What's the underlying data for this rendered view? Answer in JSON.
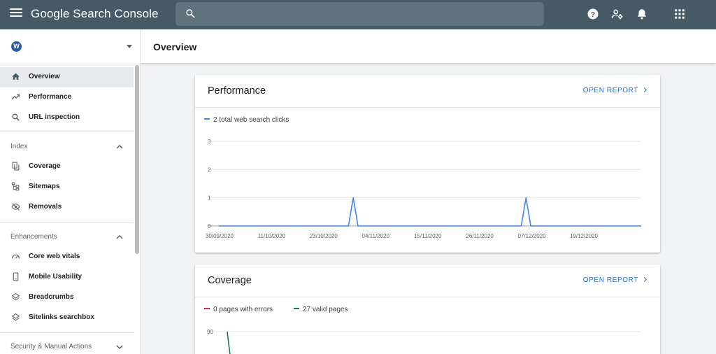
{
  "app": {
    "title": "Google Search Console",
    "search": {
      "value": "",
      "placeholder": ""
    }
  },
  "topbar_icons": [
    "menu-icon",
    "search-icon",
    "help-icon",
    "manage-users-icon",
    "notifications-icon",
    "apps-grid-icon"
  ],
  "property": {
    "logo_letter": "W",
    "icon": "wordpress-icon"
  },
  "sidebar": {
    "main_items": [
      {
        "label": "Overview",
        "icon": "home-icon",
        "active": true
      },
      {
        "label": "Performance",
        "icon": "trending-up-icon"
      },
      {
        "label": "URL inspection",
        "icon": "search-icon"
      }
    ],
    "sections": [
      {
        "title": "Index",
        "expanded": true,
        "items": [
          {
            "label": "Coverage",
            "icon": "coverage-icon"
          },
          {
            "label": "Sitemaps",
            "icon": "sitemap-icon"
          },
          {
            "label": "Removals",
            "icon": "removals-icon"
          }
        ]
      },
      {
        "title": "Enhancements",
        "expanded": true,
        "items": [
          {
            "label": "Core web vitals",
            "icon": "gauge-icon"
          },
          {
            "label": "Mobile Usability",
            "icon": "phone-icon"
          },
          {
            "label": "Breadcrumbs",
            "icon": "layers-icon"
          },
          {
            "label": "Sitelinks searchbox",
            "icon": "layers-icon"
          }
        ]
      },
      {
        "title": "Security & Manual Actions",
        "expanded": false,
        "items": []
      }
    ]
  },
  "page": {
    "title": "Overview"
  },
  "performance_card": {
    "title": "Performance",
    "open_report": "OPEN REPORT",
    "legend": [
      {
        "label": "2 total web search clicks",
        "color": "#4285f4"
      }
    ]
  },
  "coverage_card": {
    "title": "Coverage",
    "open_report": "OPEN REPORT",
    "legend": [
      {
        "label": "0 pages with errors",
        "color": "#d93025"
      },
      {
        "label": "27 valid pages",
        "color": "#188038"
      }
    ]
  },
  "chart_data": [
    {
      "type": "line",
      "title": "Performance",
      "xlabel": "",
      "ylabel": "",
      "ylim": [
        0,
        3
      ],
      "yticks": [
        "0",
        "1",
        "2",
        "3"
      ],
      "xticks": [
        "30/09/2020",
        "11/10/2020",
        "23/10/2020",
        "04/11/2020",
        "15/11/2020",
        "26/11/2020",
        "07/12/2020",
        "19/12/2020"
      ],
      "xrange": [
        "2020-09-30",
        "2020-12-27"
      ],
      "series": [
        {
          "name": "2 total web search clicks",
          "color": "#4285f4",
          "points": [
            {
              "x": "2020-09-30",
              "y": 0
            },
            {
              "x": "2020-10-27",
              "y": 0
            },
            {
              "x": "2020-10-28",
              "y": 1
            },
            {
              "x": "2020-10-29",
              "y": 0
            },
            {
              "x": "2020-12-02",
              "y": 0
            },
            {
              "x": "2020-12-03",
              "y": 1
            },
            {
              "x": "2020-12-04",
              "y": 0
            },
            {
              "x": "2020-12-27",
              "y": 0
            }
          ]
        }
      ],
      "grid": true,
      "legend": "top-left"
    },
    {
      "type": "line",
      "title": "Coverage",
      "ylim": [
        0,
        90
      ],
      "yticks": [
        "90"
      ],
      "series": [
        {
          "name": "0 pages with errors",
          "color": "#d93025",
          "values": []
        },
        {
          "name": "27 valid pages",
          "color": "#188038",
          "values": [
            90,
            80
          ]
        }
      ],
      "grid": true,
      "legend": "top-left"
    }
  ]
}
